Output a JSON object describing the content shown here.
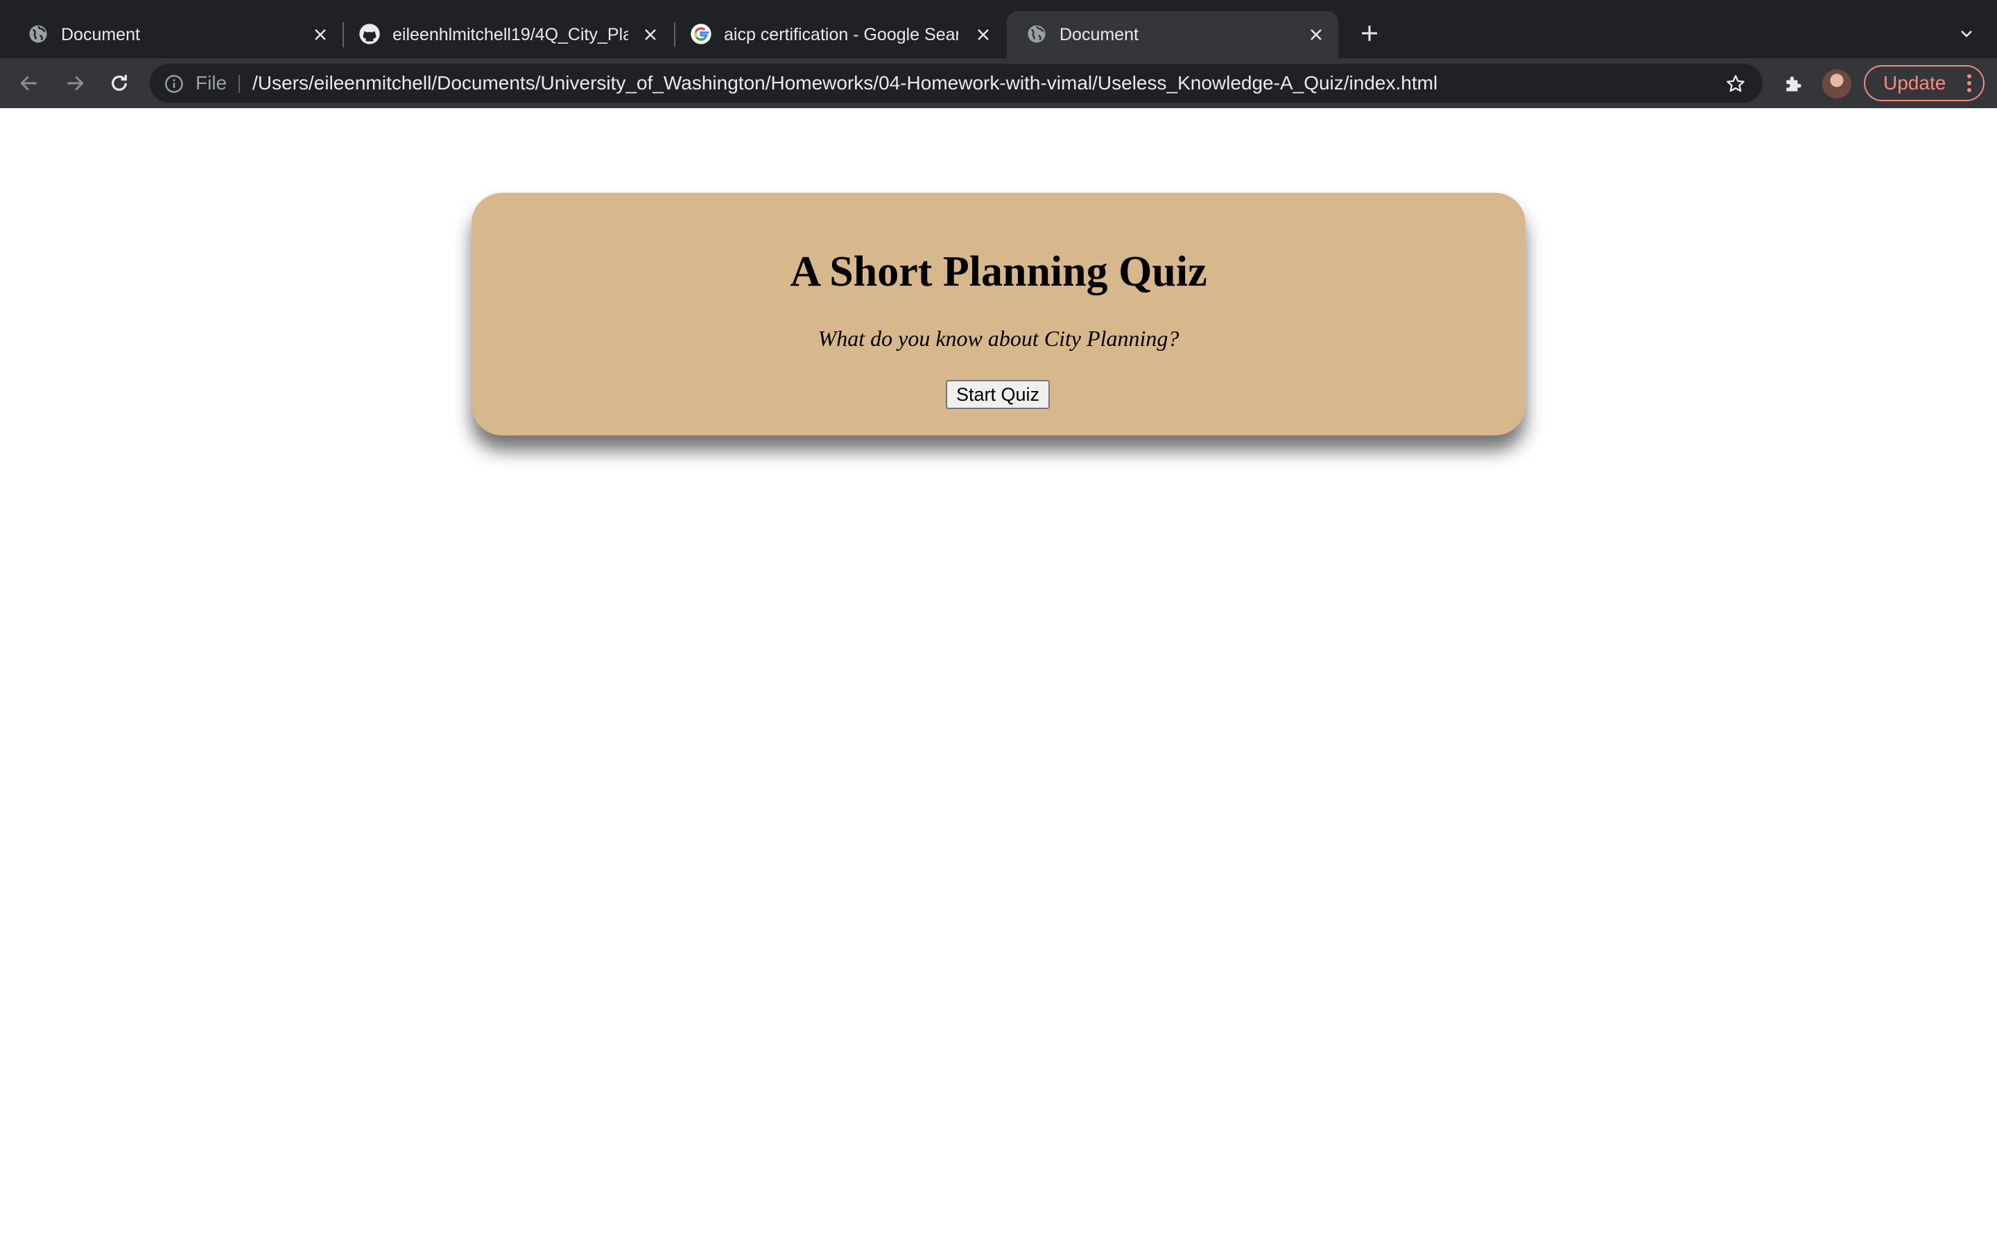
{
  "browser": {
    "tabs": [
      {
        "title": "Document",
        "favicon": "globe-icon",
        "active": false
      },
      {
        "title": "eileenhlmitchell19/4Q_City_Pla",
        "favicon": "github-icon",
        "active": false
      },
      {
        "title": "aicp certification - Google Sear",
        "favicon": "google-icon",
        "active": false
      },
      {
        "title": "Document",
        "favicon": "globe-icon",
        "active": true
      }
    ],
    "address_bar": {
      "scheme_label": "File",
      "url": "/Users/eileenmitchell/Documents/University_of_Washington/Homeworks/04-Homework-with-vimal/Useless_Knowledge-A_Quiz/index.html"
    },
    "update_label": "Update"
  },
  "page": {
    "title": "A Short Planning Quiz",
    "subtitle": "What do you know about City Planning?",
    "start_button_label": "Start Quiz"
  },
  "colors": {
    "tabstrip_bg": "#202124",
    "toolbar_bg": "#35363a",
    "card_bg": "#d7b78c",
    "update_accent": "#f28b82"
  }
}
